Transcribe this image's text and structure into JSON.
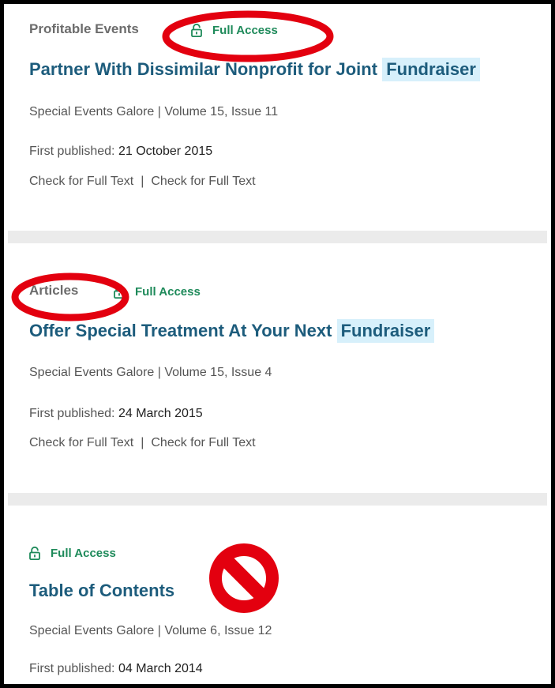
{
  "results": [
    {
      "category": "Profitable Events",
      "access_label": "Full Access",
      "title_main": "Partner With Dissimilar Nonprofit for Joint",
      "title_highlight": "Fundraiser",
      "publication": "Special Events Galore | Volume 15, Issue 11",
      "published_label": "First published:",
      "published_date": "21 October 2015",
      "link_1": "Check for Full Text",
      "link_2": "Check for Full Text"
    },
    {
      "category": "Articles",
      "access_label": "Full Access",
      "title_main": "Offer Special Treatment At Your Next",
      "title_highlight": "Fundraiser",
      "publication": "Special Events Galore | Volume 15, Issue 4",
      "published_label": "First published:",
      "published_date": "24 March 2015",
      "link_1": "Check for Full Text",
      "link_2": "Check for Full Text"
    },
    {
      "category": "",
      "access_label": "Full Access",
      "title_main": "Table of Contents",
      "title_highlight": "",
      "publication": "Special Events Galore | Volume 6, Issue 12",
      "published_label": "First published:",
      "published_date": "04 March 2014"
    }
  ],
  "link_separator": "|",
  "colors": {
    "access_green": "#1e8a5a",
    "title_blue": "#1d5c7c",
    "highlight_bg": "#d7f0fb",
    "annotation_red": "#e3000f"
  },
  "icons": {
    "access": "unlocked-padlock-icon",
    "annotation": "prohibition-icon"
  }
}
